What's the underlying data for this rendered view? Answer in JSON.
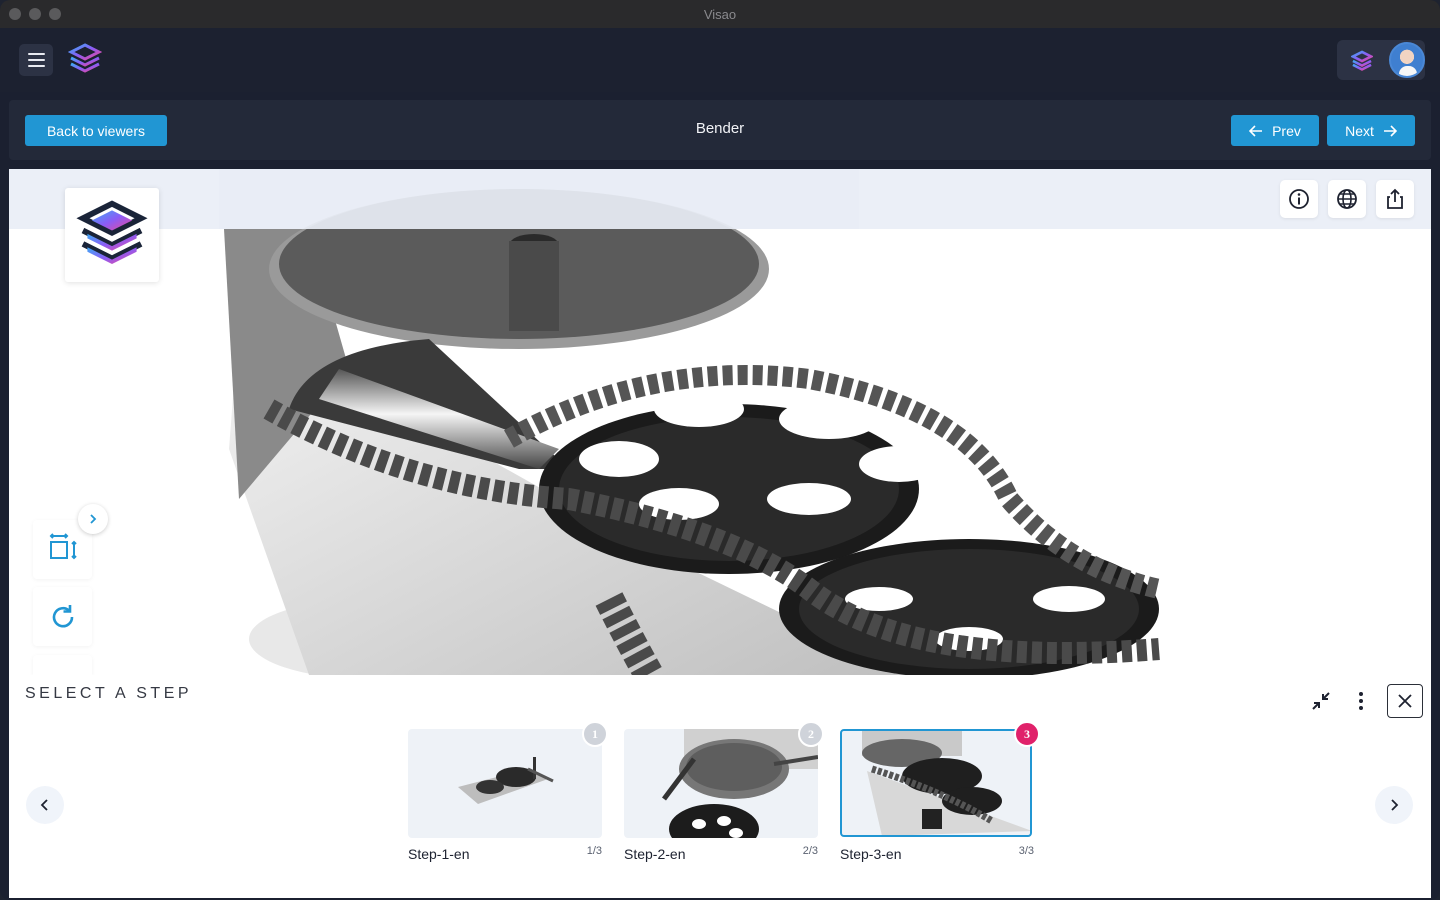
{
  "window": {
    "title": "Visao"
  },
  "toolbar": {
    "back_label": "Back to viewers",
    "title": "Bender",
    "prev_label": "Prev",
    "next_label": "Next"
  },
  "viewer": {
    "tools_top": [
      "info-icon",
      "globe-icon",
      "share-icon"
    ],
    "tools_side": [
      "fit-view-icon",
      "reset-view-icon"
    ]
  },
  "drawer": {
    "title": "SELECT A STEP",
    "steps": [
      {
        "label": "Step-1-en",
        "fraction": "1/3",
        "badge": "1",
        "active": false
      },
      {
        "label": "Step-2-en",
        "fraction": "2/3",
        "badge": "2",
        "active": false
      },
      {
        "label": "Step-3-en",
        "fraction": "3/3",
        "badge": "3",
        "active": true
      }
    ]
  },
  "colors": {
    "accent": "#2196d3",
    "active_badge": "#e0216a",
    "app_bg": "#1c2130"
  }
}
